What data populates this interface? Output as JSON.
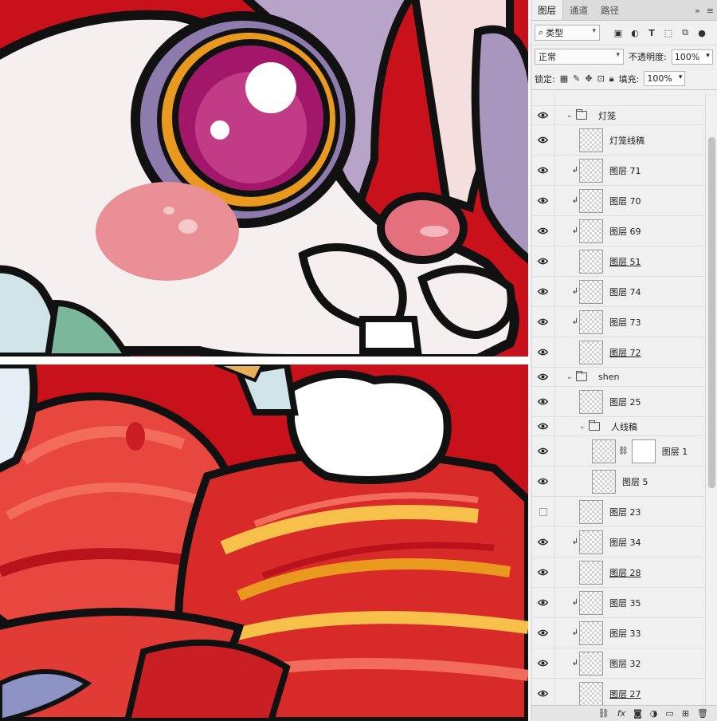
{
  "tabs": [
    {
      "label": "图层",
      "active": true
    },
    {
      "label": "通道",
      "active": false
    },
    {
      "label": "路径",
      "active": false
    }
  ],
  "tab_controls": {
    "collapse": "»",
    "menu": "≡"
  },
  "filter": {
    "value": "类型"
  },
  "blend": {
    "mode": "正常",
    "opacity_label": "不透明度:",
    "opacity": "100%"
  },
  "lock": {
    "label": "锁定:",
    "fill_label": "填充:",
    "fill": "100%"
  },
  "layers": [
    {
      "type": "group",
      "name": "灯笼",
      "visible": true,
      "depth": 0
    },
    {
      "type": "layer",
      "name": "灯笼线稿",
      "visible": true,
      "depth": 1,
      "clip": false,
      "underline": false
    },
    {
      "type": "layer",
      "name": "图层 71",
      "visible": true,
      "depth": 1,
      "clip": true,
      "underline": false
    },
    {
      "type": "layer",
      "name": "图层 70",
      "visible": true,
      "depth": 1,
      "clip": true,
      "underline": false
    },
    {
      "type": "layer",
      "name": "图层 69",
      "visible": true,
      "depth": 1,
      "clip": true,
      "underline": false
    },
    {
      "type": "layer",
      "name": "图层 51",
      "visible": true,
      "depth": 1,
      "clip": false,
      "underline": true
    },
    {
      "type": "layer",
      "name": "图层 74",
      "visible": true,
      "depth": 1,
      "clip": true,
      "underline": false
    },
    {
      "type": "layer",
      "name": "图层 73",
      "visible": true,
      "depth": 1,
      "clip": true,
      "underline": false
    },
    {
      "type": "layer",
      "name": "图层 72",
      "visible": true,
      "depth": 1,
      "clip": false,
      "underline": true
    },
    {
      "type": "group",
      "name": "shen",
      "visible": true,
      "depth": 0
    },
    {
      "type": "layer",
      "name": "图层 25",
      "visible": true,
      "depth": 1,
      "clip": false,
      "underline": false
    },
    {
      "type": "group",
      "name": "人线稿",
      "visible": true,
      "depth": 1
    },
    {
      "type": "layer",
      "name": "图层 1",
      "visible": true,
      "depth": 2,
      "clip": false,
      "underline": false,
      "mask": true
    },
    {
      "type": "layer",
      "name": "图层 5",
      "visible": true,
      "depth": 2,
      "clip": false,
      "underline": false
    },
    {
      "type": "layer",
      "name": "图层 23",
      "visible": false,
      "depth": 1,
      "clip": false,
      "underline": false
    },
    {
      "type": "layer",
      "name": "图层 34",
      "visible": true,
      "depth": 1,
      "clip": true,
      "underline": false
    },
    {
      "type": "layer",
      "name": "图层 28",
      "visible": true,
      "depth": 1,
      "clip": false,
      "underline": true
    },
    {
      "type": "layer",
      "name": "图层 35",
      "visible": true,
      "depth": 1,
      "clip": true,
      "underline": false
    },
    {
      "type": "layer",
      "name": "图层 33",
      "visible": true,
      "depth": 1,
      "clip": true,
      "underline": false
    },
    {
      "type": "layer",
      "name": "图层 32",
      "visible": true,
      "depth": 1,
      "clip": true,
      "underline": false
    },
    {
      "type": "layer",
      "name": "图层 27",
      "visible": true,
      "depth": 1,
      "clip": false,
      "underline": true
    }
  ],
  "bottom_tools": [
    "link-icon",
    "fx-icon",
    "mask-icon",
    "adjustment-icon",
    "folder-icon",
    "new-layer-icon",
    "trash-icon"
  ],
  "colors": {
    "canvas_red": "#c8111a",
    "panel_bg": "#f0f0f0"
  }
}
